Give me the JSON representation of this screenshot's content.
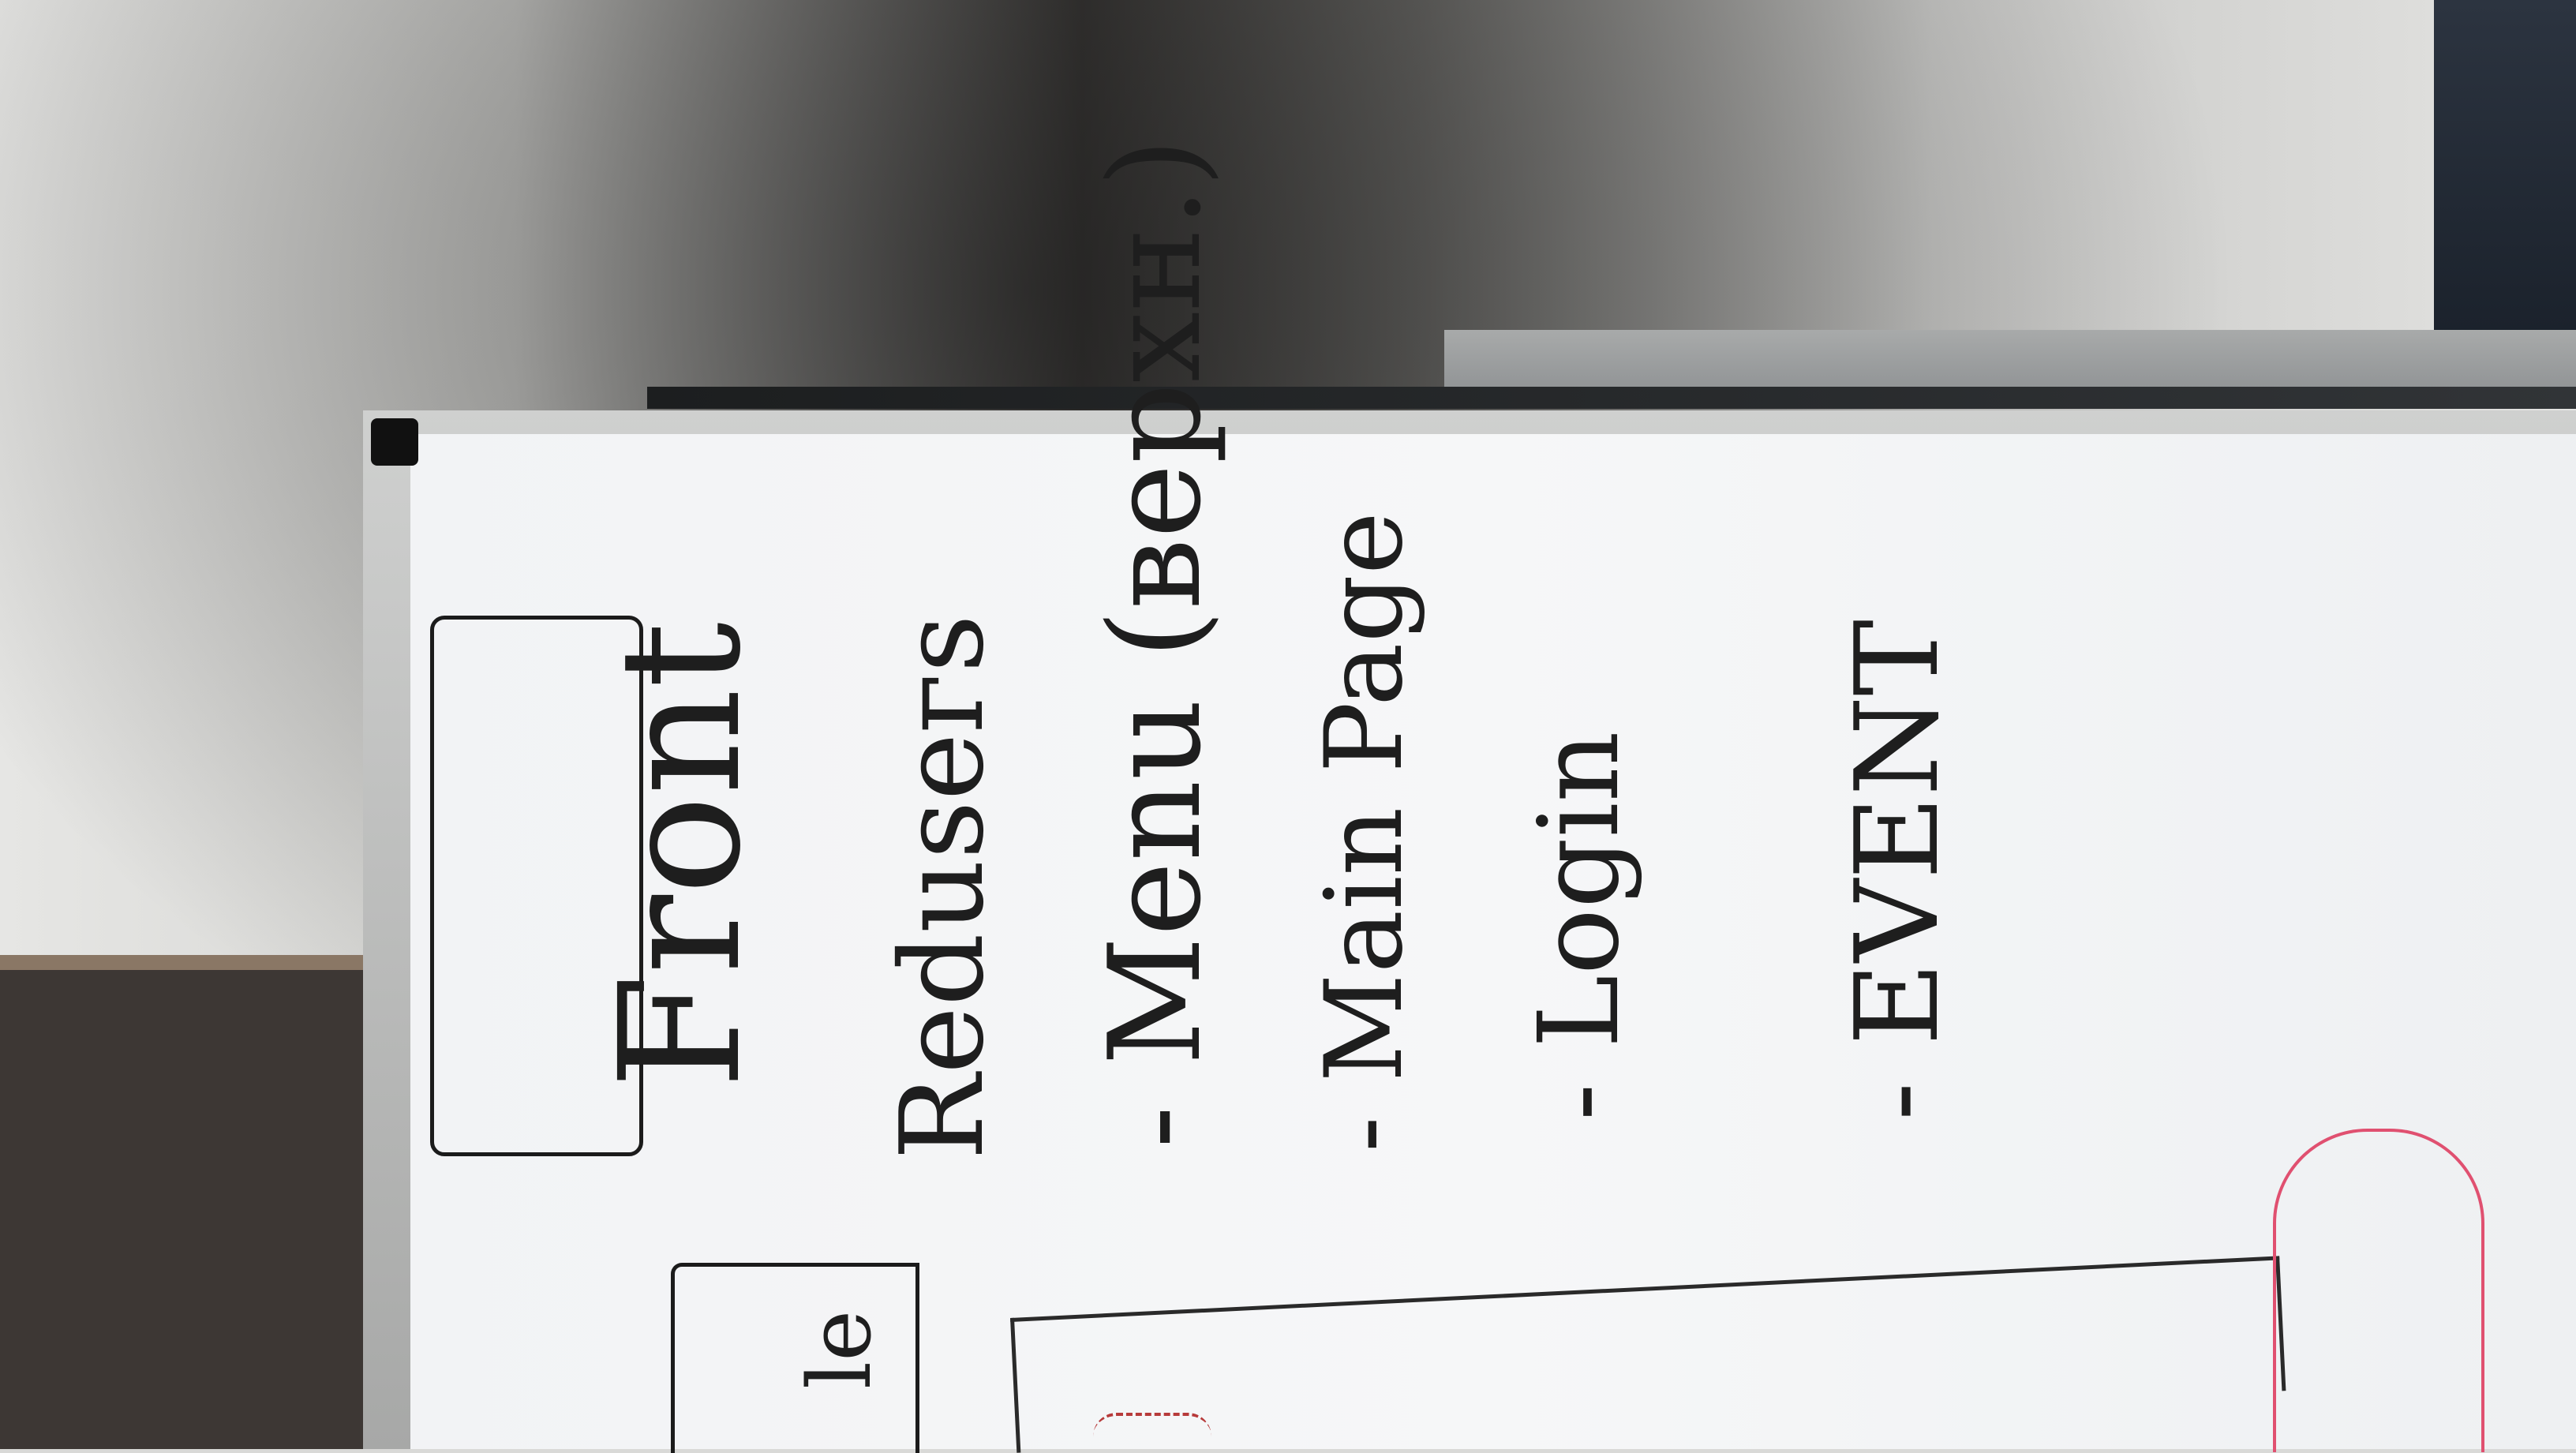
{
  "board_text": {
    "front_label": "Front",
    "reducers_heading": "Reduseгs",
    "menu_item": "- Menu (верхн.)",
    "main_page_item": "- Main Page",
    "login_item": "- Login",
    "event_item": "- EVENT",
    "small_left_text": "le"
  },
  "colors": {
    "ink": "#1e1e1e",
    "pink_marker": "#e05070",
    "board_white": "#f3f4f6"
  }
}
